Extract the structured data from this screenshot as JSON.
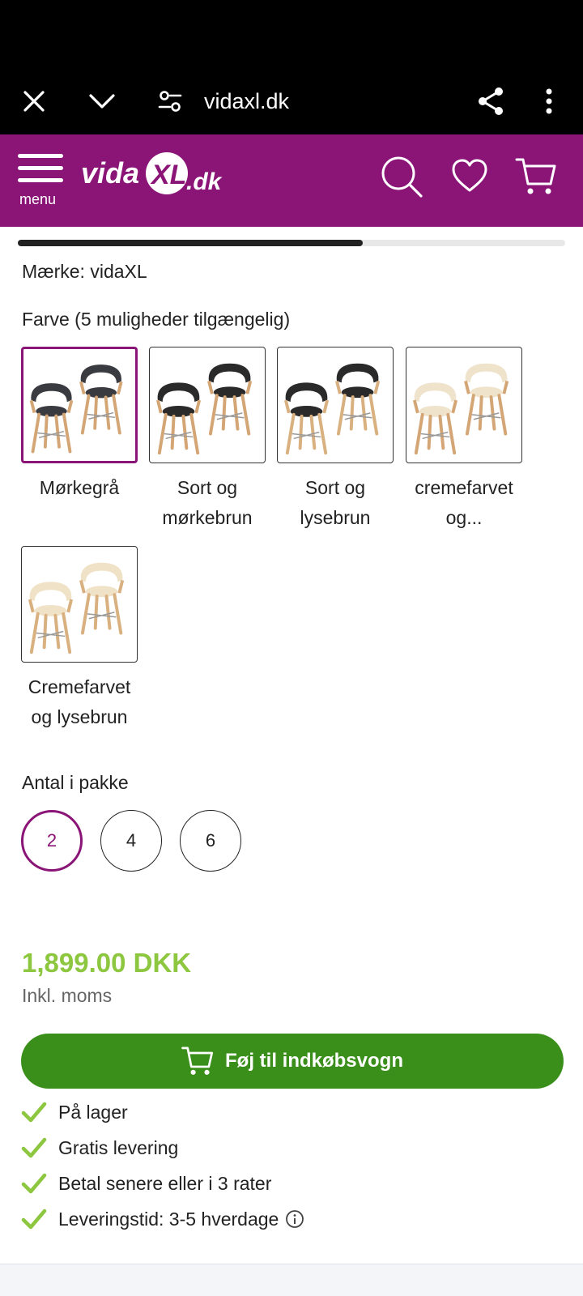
{
  "browser": {
    "url": "vidaxl.dk"
  },
  "header": {
    "menu_label": "menu",
    "logo_text": "vidaXL.dk"
  },
  "gallery_progress": 0.63,
  "product": {
    "brand_line": "Mærke: vidaXL",
    "color_heading": "Farve (5 muligheder tilgængelig)",
    "colors": [
      {
        "line1": "Mørkegrå",
        "line2": "",
        "selected": true
      },
      {
        "line1": "Sort og",
        "line2": "mørkebrun",
        "selected": false
      },
      {
        "line1": "Sort og",
        "line2": "lysebrun",
        "selected": false
      },
      {
        "line1": "cremefarvet",
        "line2": "og...",
        "selected": false
      },
      {
        "line1": "Cremefarvet",
        "line2": "og lysebrun",
        "selected": false
      }
    ],
    "qty_heading": "Antal i pakke",
    "qty_options": [
      "2",
      "4",
      "6"
    ],
    "qty_selected": "2",
    "price": "1,899.00 DKK",
    "vat_note": "Inkl. moms",
    "add_to_cart_label": "Føj til indkøbsvogn",
    "usps": [
      "På lager",
      "Gratis levering",
      "Betal senere eller i 3 rater",
      "Leveringstid: 3-5 hverdage"
    ]
  },
  "colors": {
    "brand_purple": "#8a1577",
    "price_green": "#8dc63f",
    "cart_green": "#3a8f1b",
    "check_green": "#8dc63f"
  },
  "icons": [
    "close-icon",
    "chevron-down-icon",
    "site-settings-icon",
    "share-icon",
    "more-vert-icon",
    "hamburger-icon",
    "search-icon",
    "heart-icon",
    "cart-icon",
    "check-icon",
    "info-icon"
  ]
}
